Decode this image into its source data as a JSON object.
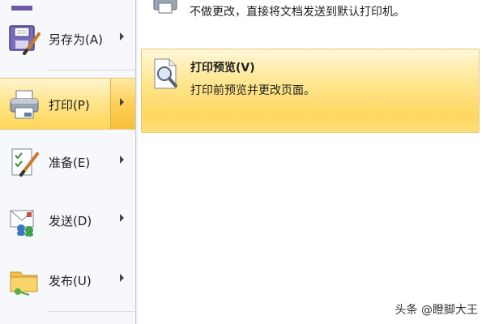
{
  "menu": {
    "items": [
      {
        "label": "另存为(A)",
        "icon": "save-as-icon",
        "has_submenu": true
      },
      {
        "label": "打印(P)",
        "icon": "printer-icon",
        "has_submenu": true,
        "selected": true
      },
      {
        "label": "准备(E)",
        "icon": "prepare-document-icon",
        "has_submenu": true
      },
      {
        "label": "发送(D)",
        "icon": "send-icon",
        "has_submenu": true
      },
      {
        "label": "发布(U)",
        "icon": "publish-folder-icon",
        "has_submenu": true
      }
    ]
  },
  "submenu": {
    "quick_print": {
      "desc": "不做更改，直接将文档发送到默认打印机。",
      "icon": "quick-print-icon"
    },
    "print_preview": {
      "title": "打印预览(V)",
      "desc": "打印前预览并更改页面。",
      "icon": "print-preview-icon",
      "highlighted": true
    }
  },
  "watermark": "头条 @瞪脚大王",
  "colors": {
    "highlight": "#ffd760",
    "pane_background": "#f7f8fb",
    "divider": "#c5cbd6"
  }
}
